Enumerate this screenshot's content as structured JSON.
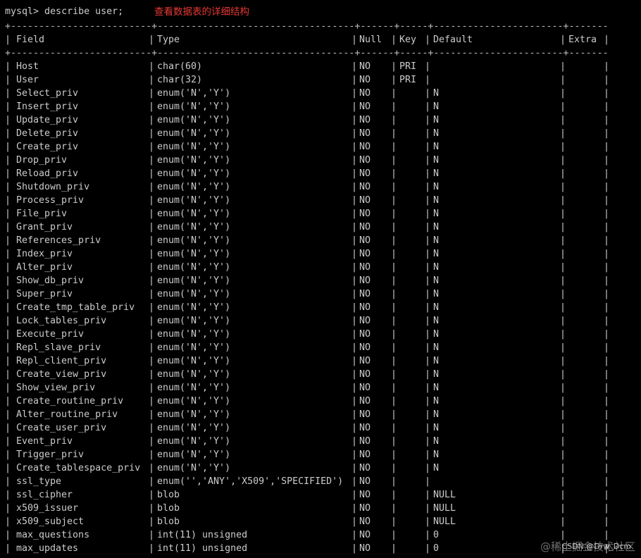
{
  "terminal": {
    "prompt": "mysql> ",
    "command": "describe user;",
    "annotation": "查看数据表的详细结构",
    "annotation_color": "#e53935",
    "background": "#000000",
    "text_color": "#cccccc"
  },
  "table": {
    "headers": {
      "field": "Field",
      "type": "Type",
      "null": "Null",
      "key": "Key",
      "default": "Default",
      "extra": "Extra"
    },
    "rows": [
      {
        "field": "Host",
        "type": "char(60)",
        "null": "NO",
        "key": "PRI",
        "default": "",
        "extra": ""
      },
      {
        "field": "User",
        "type": "char(32)",
        "null": "NO",
        "key": "PRI",
        "default": "",
        "extra": ""
      },
      {
        "field": "Select_priv",
        "type": "enum('N','Y')",
        "null": "NO",
        "key": "",
        "default": "N",
        "extra": ""
      },
      {
        "field": "Insert_priv",
        "type": "enum('N','Y')",
        "null": "NO",
        "key": "",
        "default": "N",
        "extra": ""
      },
      {
        "field": "Update_priv",
        "type": "enum('N','Y')",
        "null": "NO",
        "key": "",
        "default": "N",
        "extra": ""
      },
      {
        "field": "Delete_priv",
        "type": "enum('N','Y')",
        "null": "NO",
        "key": "",
        "default": "N",
        "extra": ""
      },
      {
        "field": "Create_priv",
        "type": "enum('N','Y')",
        "null": "NO",
        "key": "",
        "default": "N",
        "extra": ""
      },
      {
        "field": "Drop_priv",
        "type": "enum('N','Y')",
        "null": "NO",
        "key": "",
        "default": "N",
        "extra": ""
      },
      {
        "field": "Reload_priv",
        "type": "enum('N','Y')",
        "null": "NO",
        "key": "",
        "default": "N",
        "extra": ""
      },
      {
        "field": "Shutdown_priv",
        "type": "enum('N','Y')",
        "null": "NO",
        "key": "",
        "default": "N",
        "extra": ""
      },
      {
        "field": "Process_priv",
        "type": "enum('N','Y')",
        "null": "NO",
        "key": "",
        "default": "N",
        "extra": ""
      },
      {
        "field": "File_priv",
        "type": "enum('N','Y')",
        "null": "NO",
        "key": "",
        "default": "N",
        "extra": ""
      },
      {
        "field": "Grant_priv",
        "type": "enum('N','Y')",
        "null": "NO",
        "key": "",
        "default": "N",
        "extra": ""
      },
      {
        "field": "References_priv",
        "type": "enum('N','Y')",
        "null": "NO",
        "key": "",
        "default": "N",
        "extra": ""
      },
      {
        "field": "Index_priv",
        "type": "enum('N','Y')",
        "null": "NO",
        "key": "",
        "default": "N",
        "extra": ""
      },
      {
        "field": "Alter_priv",
        "type": "enum('N','Y')",
        "null": "NO",
        "key": "",
        "default": "N",
        "extra": ""
      },
      {
        "field": "Show_db_priv",
        "type": "enum('N','Y')",
        "null": "NO",
        "key": "",
        "default": "N",
        "extra": ""
      },
      {
        "field": "Super_priv",
        "type": "enum('N','Y')",
        "null": "NO",
        "key": "",
        "default": "N",
        "extra": ""
      },
      {
        "field": "Create_tmp_table_priv",
        "type": "enum('N','Y')",
        "null": "NO",
        "key": "",
        "default": "N",
        "extra": ""
      },
      {
        "field": "Lock_tables_priv",
        "type": "enum('N','Y')",
        "null": "NO",
        "key": "",
        "default": "N",
        "extra": ""
      },
      {
        "field": "Execute_priv",
        "type": "enum('N','Y')",
        "null": "NO",
        "key": "",
        "default": "N",
        "extra": ""
      },
      {
        "field": "Repl_slave_priv",
        "type": "enum('N','Y')",
        "null": "NO",
        "key": "",
        "default": "N",
        "extra": ""
      },
      {
        "field": "Repl_client_priv",
        "type": "enum('N','Y')",
        "null": "NO",
        "key": "",
        "default": "N",
        "extra": ""
      },
      {
        "field": "Create_view_priv",
        "type": "enum('N','Y')",
        "null": "NO",
        "key": "",
        "default": "N",
        "extra": ""
      },
      {
        "field": "Show_view_priv",
        "type": "enum('N','Y')",
        "null": "NO",
        "key": "",
        "default": "N",
        "extra": ""
      },
      {
        "field": "Create_routine_priv",
        "type": "enum('N','Y')",
        "null": "NO",
        "key": "",
        "default": "N",
        "extra": ""
      },
      {
        "field": "Alter_routine_priv",
        "type": "enum('N','Y')",
        "null": "NO",
        "key": "",
        "default": "N",
        "extra": ""
      },
      {
        "field": "Create_user_priv",
        "type": "enum('N','Y')",
        "null": "NO",
        "key": "",
        "default": "N",
        "extra": ""
      },
      {
        "field": "Event_priv",
        "type": "enum('N','Y')",
        "null": "NO",
        "key": "",
        "default": "N",
        "extra": ""
      },
      {
        "field": "Trigger_priv",
        "type": "enum('N','Y')",
        "null": "NO",
        "key": "",
        "default": "N",
        "extra": ""
      },
      {
        "field": "Create_tablespace_priv",
        "type": "enum('N','Y')",
        "null": "NO",
        "key": "",
        "default": "N",
        "extra": ""
      },
      {
        "field": "ssl_type",
        "type": "enum('','ANY','X509','SPECIFIED')",
        "null": "NO",
        "key": "",
        "default": "",
        "extra": ""
      },
      {
        "field": "ssl_cipher",
        "type": "blob",
        "null": "NO",
        "key": "",
        "default": "NULL",
        "extra": ""
      },
      {
        "field": "x509_issuer",
        "type": "blob",
        "null": "NO",
        "key": "",
        "default": "NULL",
        "extra": ""
      },
      {
        "field": "x509_subject",
        "type": "blob",
        "null": "NO",
        "key": "",
        "default": "NULL",
        "extra": ""
      },
      {
        "field": "max_questions",
        "type": "int(11) unsigned",
        "null": "NO",
        "key": "",
        "default": "0",
        "extra": ""
      },
      {
        "field": "max_updates",
        "type": "int(11) unsigned",
        "null": "NO",
        "key": "",
        "default": "0",
        "extra": ""
      }
    ]
  },
  "watermark": {
    "text": "@稀土掘金技术社区",
    "sub": "CSDN @Drw_Dcm"
  }
}
